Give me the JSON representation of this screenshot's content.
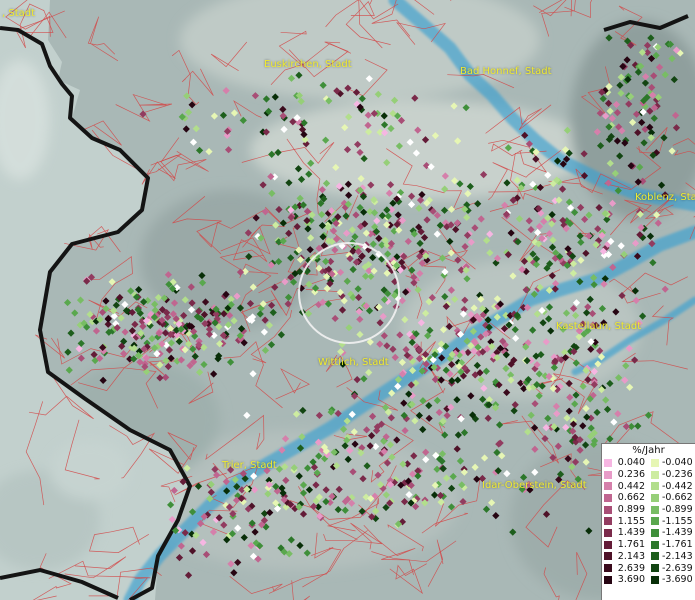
{
  "legend": {
    "title": "%/Jahr",
    "positive": [
      "0.040",
      "0.236",
      "0.442",
      "0.662",
      "0.899",
      "1.155",
      "1.439",
      "1.761",
      "2.143",
      "2.639",
      "3.690"
    ],
    "negative": [
      "-0.040",
      "-0.236",
      "-0.442",
      "-0.662",
      "-0.899",
      "-1.155",
      "-1.439",
      "-1.761",
      "-2.143",
      "-2.639",
      "-3.690"
    ],
    "positive_colors": [
      "#f6b6e2",
      "#e89bc8",
      "#d580ab",
      "#c06690",
      "#a84e76",
      "#923c60",
      "#7a2a4a",
      "#641c38",
      "#4e1228",
      "#3a0a1c",
      "#260512"
    ],
    "negative_colors": [
      "#e6f6b4",
      "#cdeca0",
      "#b2de8c",
      "#96cf78",
      "#78bd64",
      "#5aa84e",
      "#3f8f3a",
      "#2c772a",
      "#1d5e1c",
      "#124512",
      "#082e08"
    ]
  },
  "cities": [
    {
      "name": "Euskirchen, Stadt"
    },
    {
      "name": "Bad Honnef, Stadt"
    },
    {
      "name": "Koblenz, Sta"
    },
    {
      "name": "Kastellaun, Stadt"
    },
    {
      "name": "Wittlich, Stadt"
    },
    {
      "name": "Trier, Stadt"
    },
    {
      "name": "Idar-Oberstein, Stadt"
    },
    {
      "name": ", Stadt"
    }
  ],
  "colors": {
    "city_label": "#f0ea30",
    "boundary": "#d24848",
    "river": "#3aa0d0",
    "border": "#141414",
    "land": "#a9b8b6",
    "outside": "#c2d0cd"
  }
}
